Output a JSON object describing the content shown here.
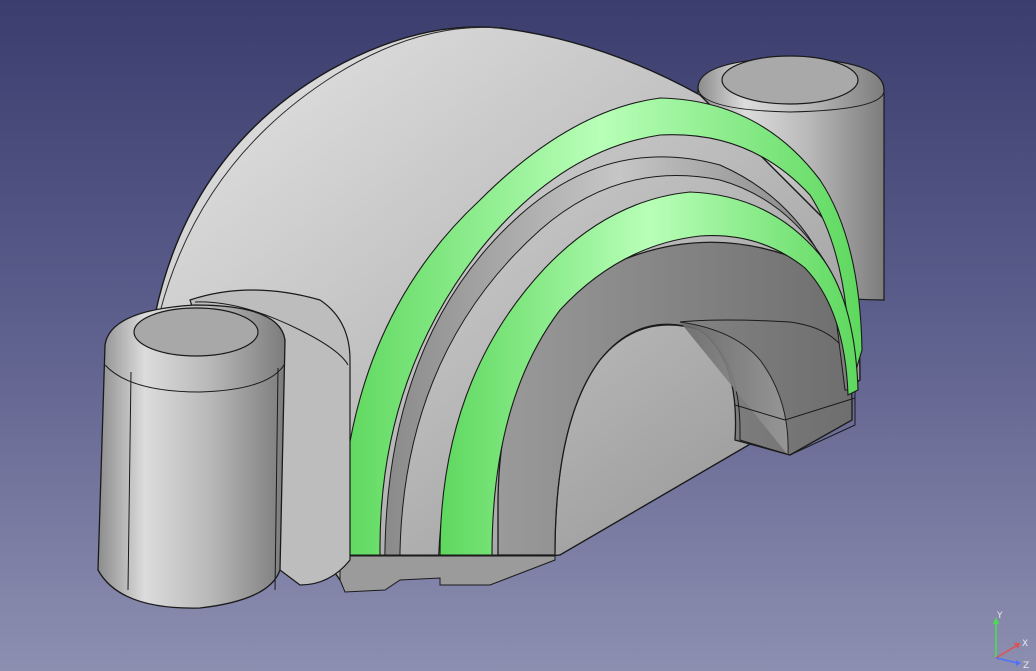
{
  "viewport": {
    "background_top": "#3b3d6e",
    "background_bottom": "#8d8fb1",
    "selection_color": "#7ff07f"
  },
  "axis_triad": {
    "y_label": "Y",
    "x_label": "X",
    "z_label": "Z",
    "y_color": "#4ddd4d",
    "x_color": "#e05050",
    "z_color": "#5070ff"
  },
  "model": {
    "selected_faces_icon": "highlighted-groove-faces",
    "part_icon": "bearing-cap-part"
  }
}
